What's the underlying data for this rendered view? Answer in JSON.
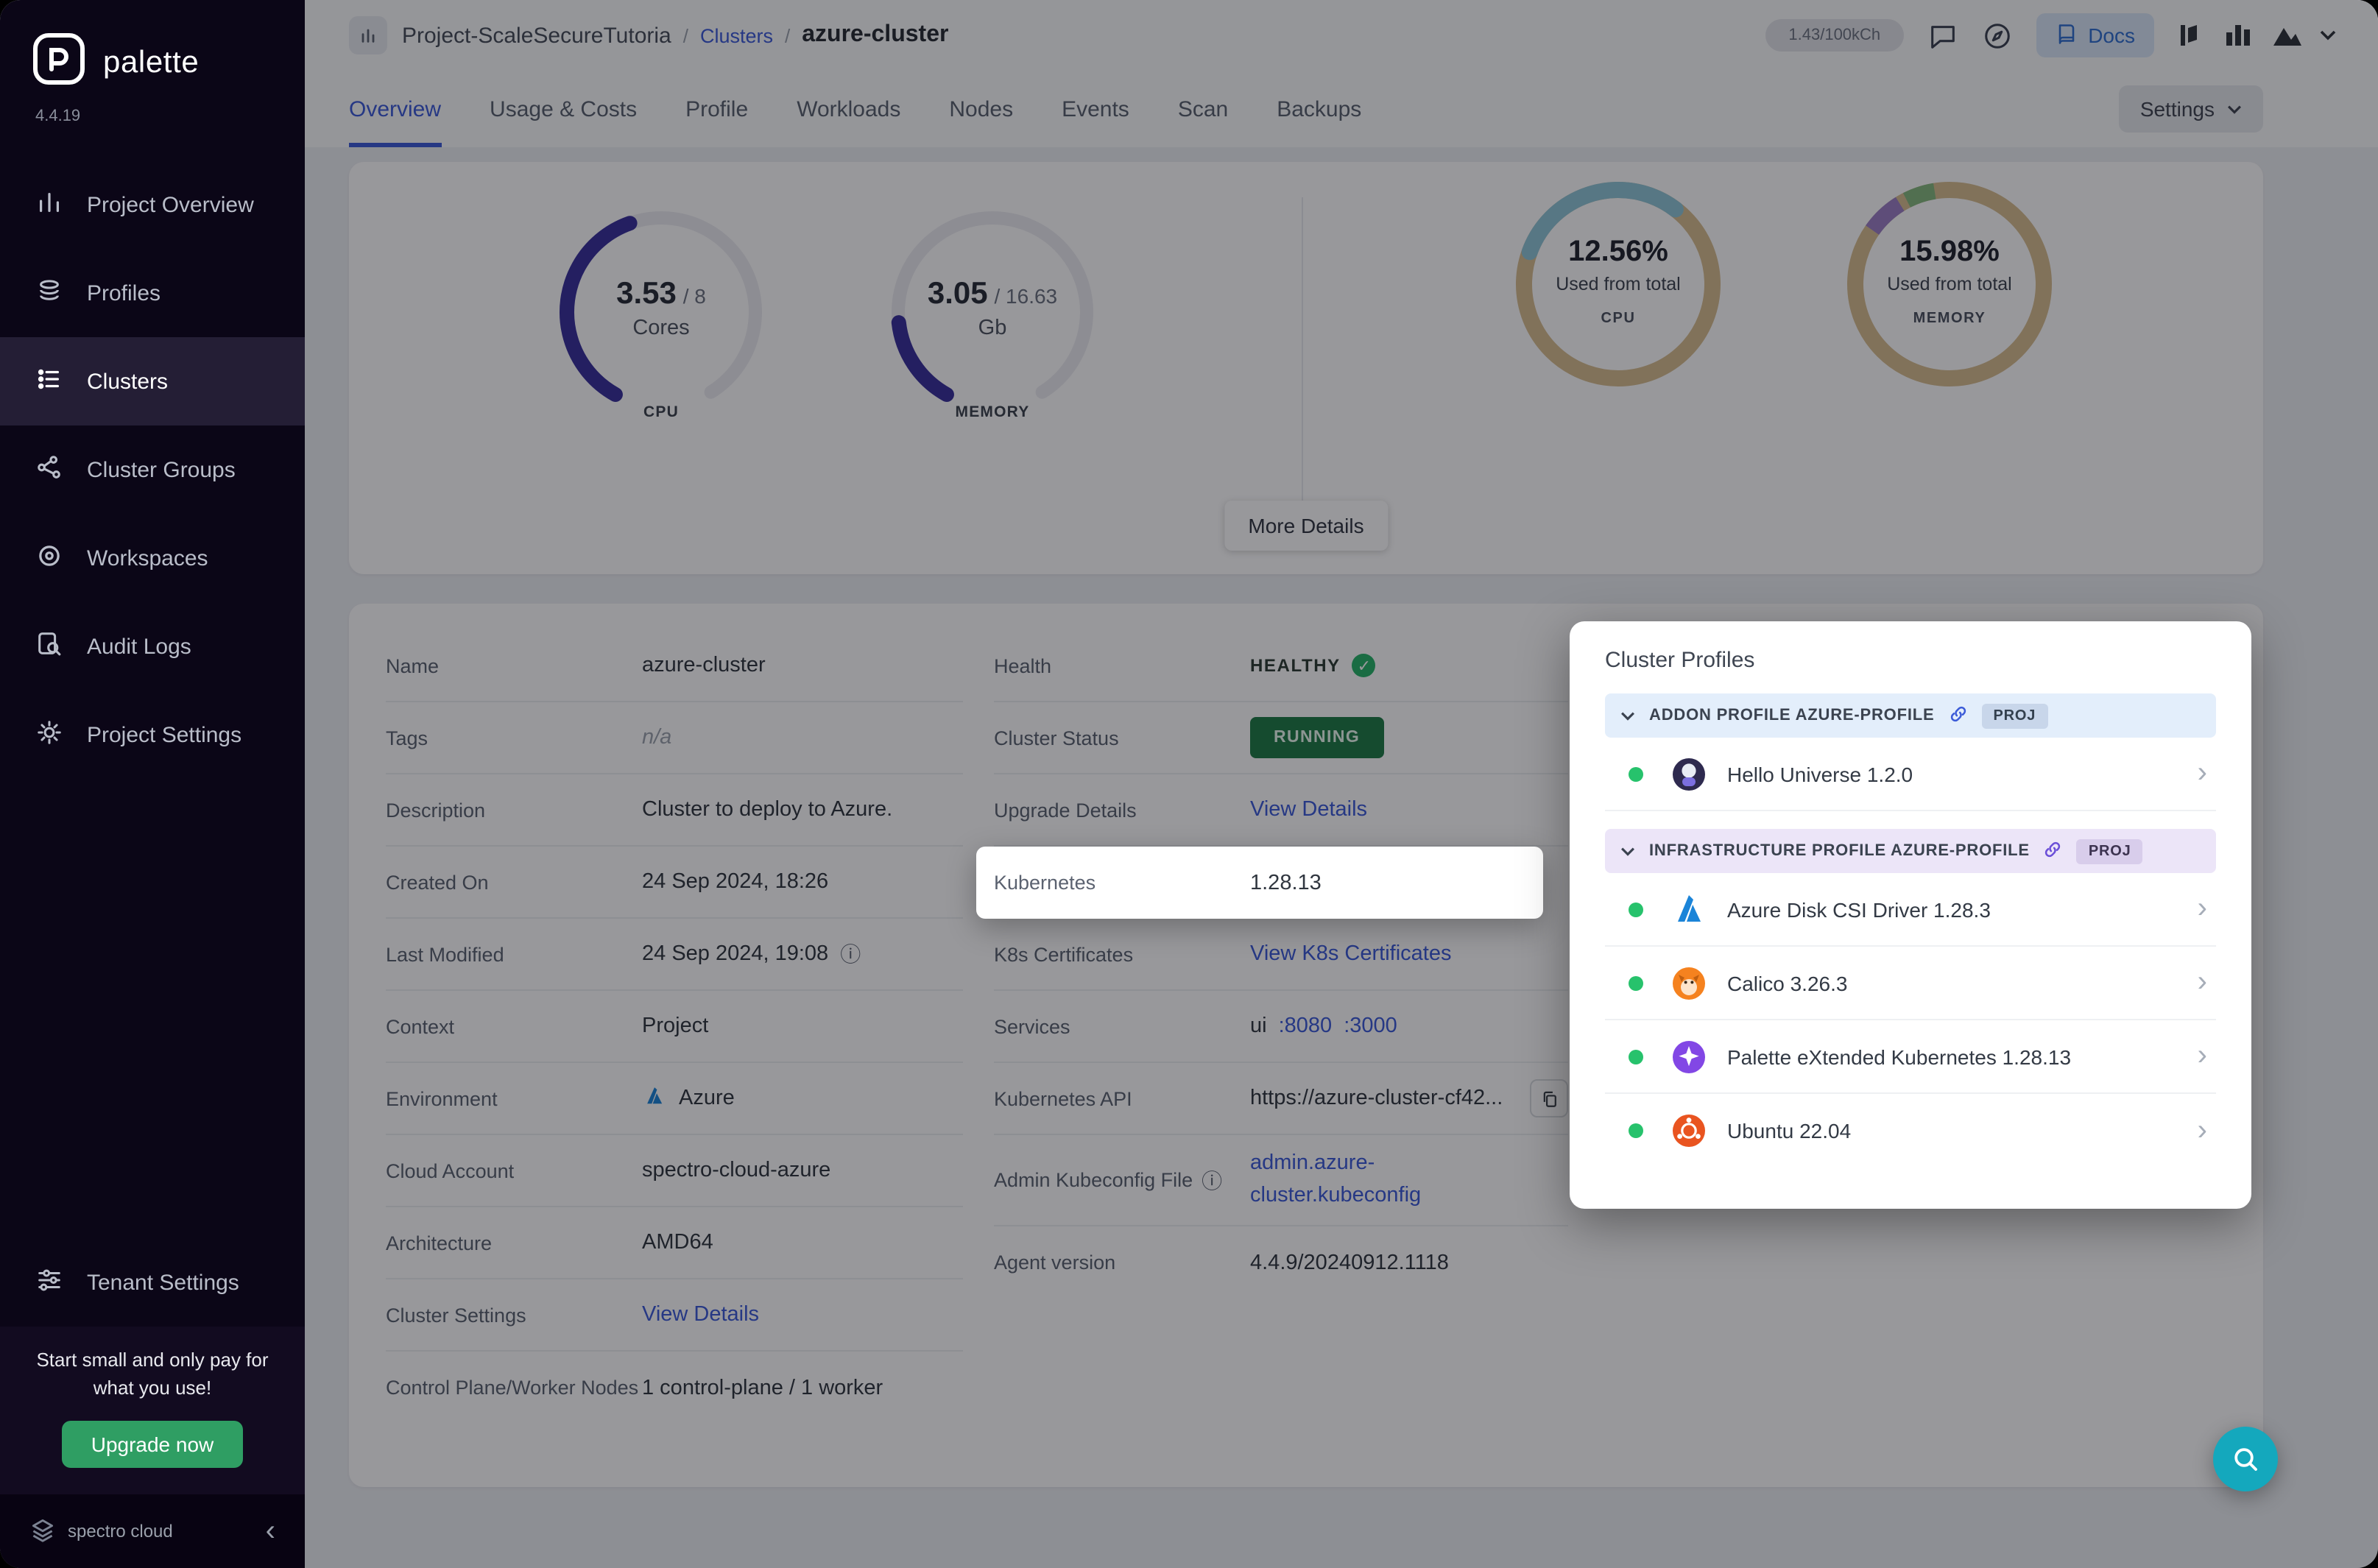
{
  "sidebar": {
    "brand": "palette",
    "version": "4.4.19",
    "items": [
      {
        "label": "Project Overview"
      },
      {
        "label": "Profiles"
      },
      {
        "label": "Clusters"
      },
      {
        "label": "Cluster Groups"
      },
      {
        "label": "Workspaces"
      },
      {
        "label": "Audit Logs"
      },
      {
        "label": "Project Settings"
      }
    ],
    "tenant_settings_label": "Tenant Settings",
    "promo_text": "Start small and only pay for what you use!",
    "upgrade_label": "Upgrade now",
    "footer_brand": "spectro cloud"
  },
  "header": {
    "project": "Project-ScaleSecureTutoria",
    "breadcrumb_sep": "/",
    "breadcrumb_section": "Clusters",
    "cluster": "azure-cluster",
    "usage": "1.43/100kCh",
    "docs": "Docs"
  },
  "tabs": {
    "labels": [
      "Overview",
      "Usage & Costs",
      "Profile",
      "Workloads",
      "Nodes",
      "Events",
      "Scan",
      "Backups"
    ],
    "settings": "Settings"
  },
  "metrics": {
    "cpu": {
      "value": "3.53",
      "total": "/ 8",
      "unit": "Cores",
      "label": "CPU"
    },
    "memory": {
      "value": "3.05",
      "total": "/ 16.63",
      "unit": "Gb",
      "label": "MEMORY"
    },
    "cpu_usage": {
      "pct": "12.56%",
      "caption": "Used from total",
      "label": "CPU"
    },
    "memory_usage": {
      "pct": "15.98%",
      "caption": "Used from total",
      "label": "MEMORY"
    },
    "more_details": "More Details"
  },
  "details": {
    "left": [
      {
        "label": "Name",
        "value": "azure-cluster"
      },
      {
        "label": "Tags",
        "value": "n/a"
      },
      {
        "label": "Description",
        "value": "Cluster to deploy to Azure."
      },
      {
        "label": "Created On",
        "value": "24 Sep 2024, 18:26"
      },
      {
        "label": "Last Modified",
        "value": "24 Sep 2024, 19:08"
      },
      {
        "label": "Context",
        "value": "Project"
      },
      {
        "label": "Environment",
        "value": "Azure"
      },
      {
        "label": "Cloud Account",
        "value": "spectro-cloud-azure"
      },
      {
        "label": "Architecture",
        "value": "AMD64"
      },
      {
        "label": "Cluster Settings",
        "value": "View Details"
      },
      {
        "label": "Control Plane/Worker Nodes",
        "value": "1 control-plane / 1 worker"
      }
    ],
    "right": {
      "health_label": "Health",
      "health_value": "HEALTHY",
      "status_label": "Cluster Status",
      "status_value": "RUNNING",
      "upgrade_label": "Upgrade Details",
      "upgrade_value": "View Details",
      "kubernetes_label": "Kubernetes",
      "kubernetes_value": "1.28.13",
      "certs_label": "K8s Certificates",
      "certs_value": "View K8s Certificates",
      "services_label": "Services",
      "services_prefix": "ui",
      "services_port1": ":8080",
      "services_port2": ":3000",
      "api_label": "Kubernetes API",
      "api_value": "https://azure-cluster-cf42...",
      "kubeconfig_label": "Admin Kubeconfig File",
      "kubeconfig_value": "admin.azure-cluster.kubeconfig",
      "agent_label": "Agent version",
      "agent_value": "4.4.9/20240912.1118"
    }
  },
  "cluster_profiles": {
    "title": "Cluster Profiles",
    "addon": {
      "header": "ADDON PROFILE AZURE-PROFILE",
      "badge": "PROJ",
      "items": [
        {
          "name": "Hello Universe 1.2.0"
        }
      ]
    },
    "infrastructure": {
      "header": "INFRASTRUCTURE PROFILE AZURE-PROFILE",
      "badge": "PROJ",
      "items": [
        {
          "name": "Azure Disk CSI Driver 1.28.3"
        },
        {
          "name": "Calico 3.26.3"
        },
        {
          "name": "Palette eXtended Kubernetes 1.28.13"
        },
        {
          "name": "Ubuntu 22.04"
        }
      ]
    }
  },
  "colors": {
    "accent_blue": "#3C5BD8",
    "sidebar_bg": "#0B0617",
    "running_green": "#1E7A46",
    "healthy_green": "#27B368",
    "upgrade_green": "#2F9E63",
    "fab_teal": "#14A8BD",
    "gauge_fill": "#37309B",
    "donut_base": "#D8BD90",
    "donut_teal": "#8FC6D8"
  }
}
